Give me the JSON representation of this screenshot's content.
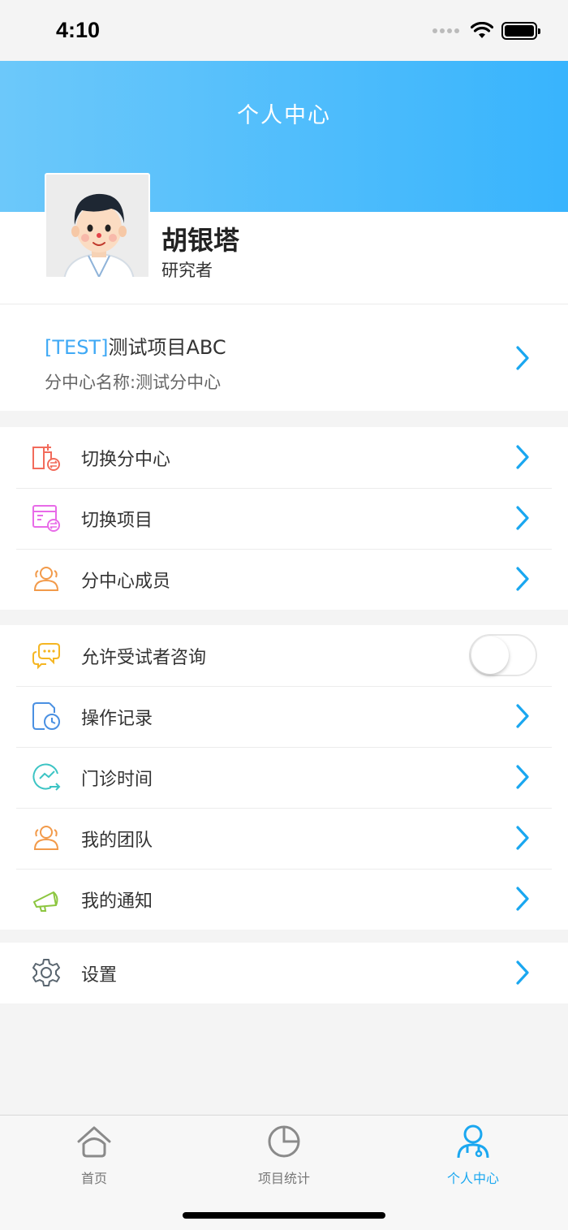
{
  "status": {
    "time": "4:10"
  },
  "header": {
    "title": "个人中心"
  },
  "profile": {
    "name": "胡银塔",
    "role": "研究者"
  },
  "project": {
    "tag": "[TEST]",
    "name": "测试项目ABC",
    "center": "分中心名称:测试分中心"
  },
  "group1": {
    "items": [
      {
        "label": "切换分中心",
        "icon": "switch-center-icon",
        "color": "#f26b5b"
      },
      {
        "label": "切换项目",
        "icon": "switch-project-icon",
        "color": "#e86be8"
      },
      {
        "label": "分中心成员",
        "icon": "members-icon",
        "color": "#f29a4a"
      }
    ]
  },
  "group2": {
    "items": [
      {
        "label": "允许受试者咨询",
        "icon": "chat-icon",
        "color": "#f5b623",
        "toggle": false
      },
      {
        "label": "操作记录",
        "icon": "record-icon",
        "color": "#4a90e2"
      },
      {
        "label": "门诊时间",
        "icon": "clinic-time-icon",
        "color": "#3cc4c4"
      },
      {
        "label": "我的团队",
        "icon": "team-icon",
        "color": "#f29a4a"
      },
      {
        "label": "我的通知",
        "icon": "notification-icon",
        "color": "#8cc63f"
      }
    ]
  },
  "group3": {
    "items": [
      {
        "label": "设置",
        "icon": "settings-icon",
        "color": "#5a6670"
      }
    ]
  },
  "tabbar": {
    "tabs": [
      {
        "label": "首页",
        "icon": "home-icon",
        "active": false
      },
      {
        "label": "项目统计",
        "icon": "pie-chart-icon",
        "active": false
      },
      {
        "label": "个人中心",
        "icon": "person-icon",
        "active": true
      }
    ]
  },
  "colors": {
    "accent": "#1aa7f0",
    "header_start": "#6cc8fa",
    "header_end": "#38b4fd"
  }
}
